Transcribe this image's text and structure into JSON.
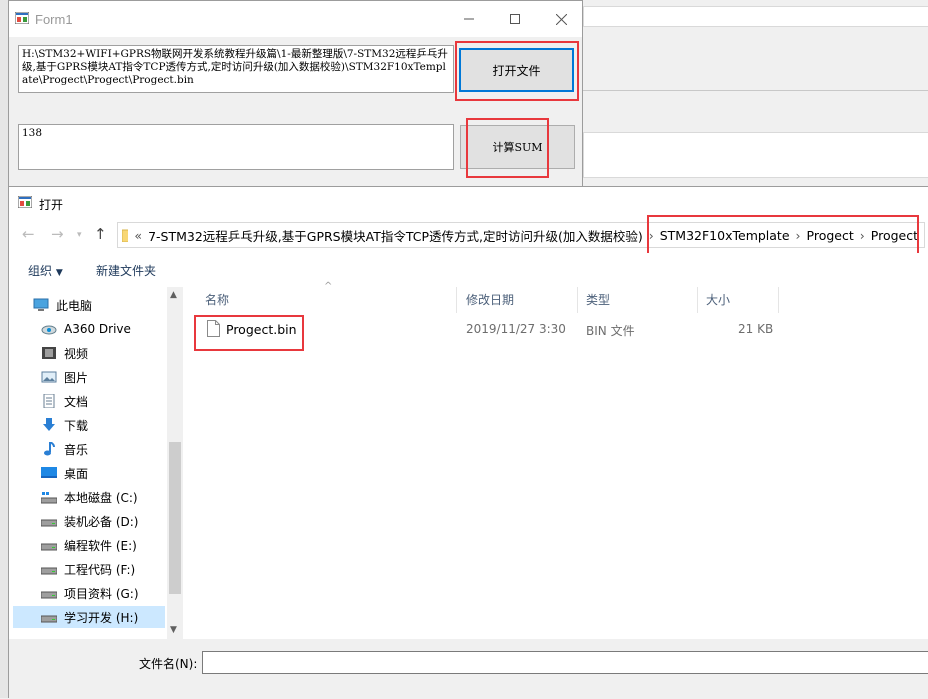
{
  "form1": {
    "title": "Form1",
    "path_text": "H:\\STM32+WIFI+GPRS物联网开发系统教程升级篇\\1-最新整理版\\7-STM32远程乒乓升级,基于GPRS模块AT指令TCP透传方式,定时访问升级(加入数据校验)\\STM32F10xTemplate\\Progect\\Progect\\Progect.bin",
    "sum_text": "138",
    "open_button": "打开文件",
    "sum_button": "计算SUM"
  },
  "dialog": {
    "title": "打开",
    "breadcrumb": {
      "overflow": "«",
      "segments": [
        "7-STM32远程乒乓升级,基于GPRS模块AT指令TCP透传方式,定时访问升级(加入数据校验)",
        "STM32F10xTemplate",
        "Progect",
        "Progect"
      ]
    },
    "toolbar": {
      "organize": "组织",
      "new_folder": "新建文件夹"
    },
    "nav": [
      {
        "label": "此电脑",
        "icon": "computer-icon"
      },
      {
        "label": "A360 Drive",
        "icon": "cloud-drive-icon"
      },
      {
        "label": "视频",
        "icon": "video-folder-icon"
      },
      {
        "label": "图片",
        "icon": "pictures-folder-icon"
      },
      {
        "label": "文档",
        "icon": "documents-folder-icon"
      },
      {
        "label": "下载",
        "icon": "download-folder-icon"
      },
      {
        "label": "音乐",
        "icon": "music-folder-icon"
      },
      {
        "label": "桌面",
        "icon": "desktop-folder-icon"
      },
      {
        "label": "本地磁盘 (C:)",
        "icon": "system-drive-icon"
      },
      {
        "label": "装机必备 (D:)",
        "icon": "drive-icon"
      },
      {
        "label": "编程软件 (E:)",
        "icon": "drive-icon"
      },
      {
        "label": "工程代码 (F:)",
        "icon": "drive-icon"
      },
      {
        "label": "项目资料 (G:)",
        "icon": "drive-icon"
      },
      {
        "label": "学习开发 (H:)",
        "icon": "drive-icon"
      }
    ],
    "columns": [
      "名称",
      "修改日期",
      "类型",
      "大小"
    ],
    "files": [
      {
        "name": "Progect.bin",
        "modified": "2019/11/27 3:30",
        "type": "BIN 文件",
        "size": "21 KB"
      }
    ],
    "filename_label": "文件名(N):",
    "filename_value": ""
  },
  "colors": {
    "highlight": "#e8383d",
    "selection": "#cce8ff",
    "button_focus": "#0078d7"
  }
}
